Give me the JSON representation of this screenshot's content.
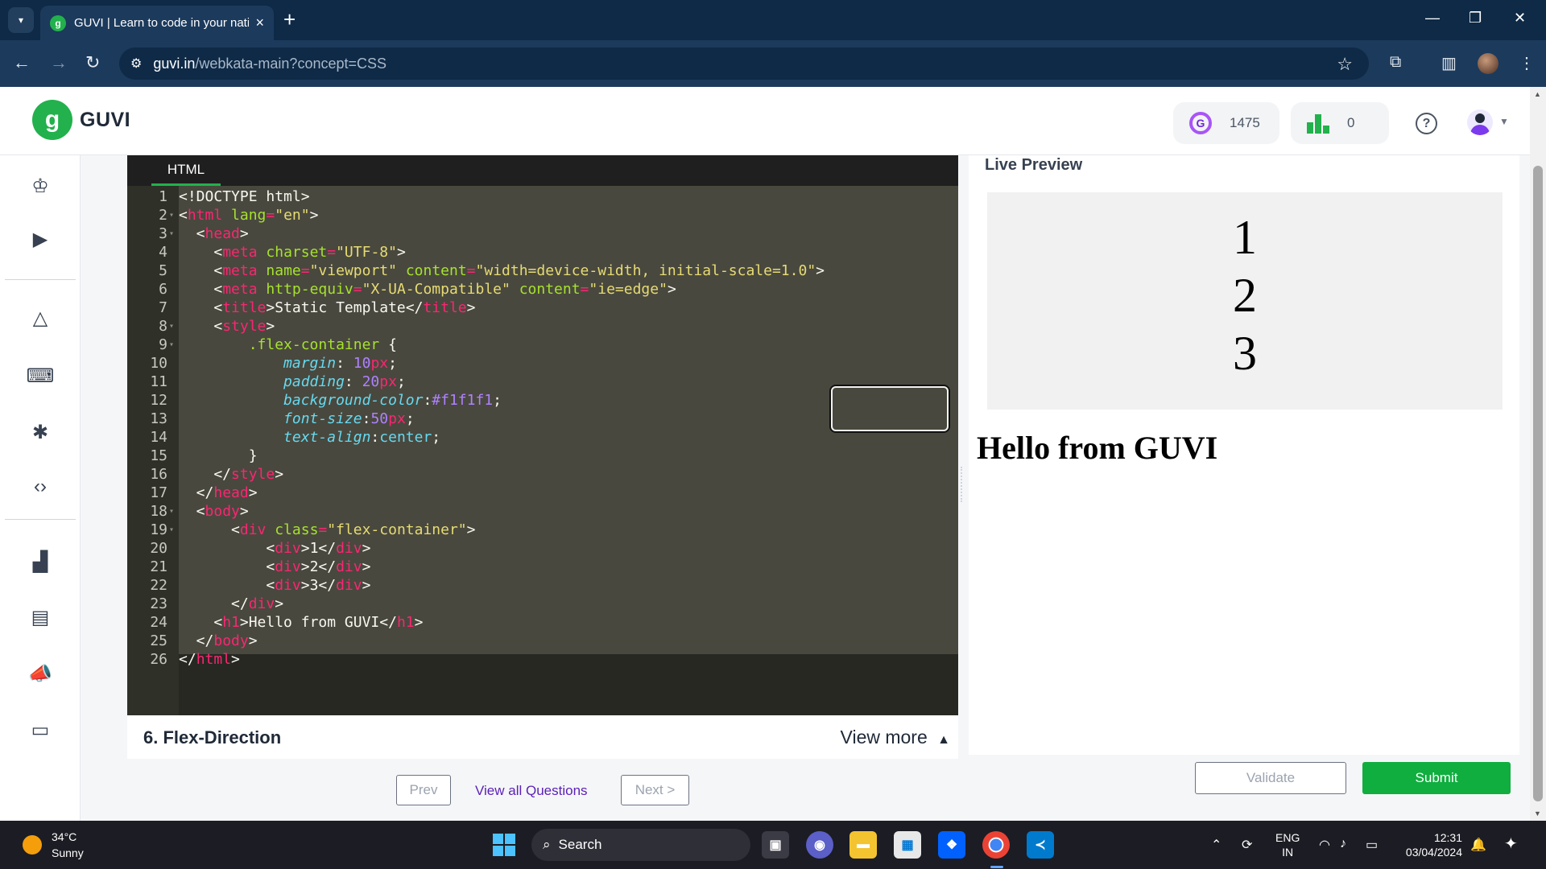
{
  "browser": {
    "tab_title": "GUVI | Learn to code in your native language",
    "tab_favicon": "g",
    "url_host": "guvi.in",
    "url_path": "/webkata-main?concept=CSS"
  },
  "header": {
    "logo_letter": "g",
    "logo_text": "GUVI",
    "gems_icon_letter": "G",
    "gems": "1475",
    "rank": "0",
    "help": "?"
  },
  "editor": {
    "tab_label": "HTML",
    "lines": [
      {
        "n": "1",
        "fold": "",
        "html": "<span>&lt;!DOCTYPE html&gt;</span>"
      },
      {
        "n": "2",
        "fold": "▾",
        "html": "&lt;<span class='ct'>html</span> <span class='ca'>lang</span><span class='ct'>=</span><span class='cs'>\"en\"</span>&gt;"
      },
      {
        "n": "3",
        "fold": "▾",
        "html": "  &lt;<span class='ct'>head</span>&gt;"
      },
      {
        "n": "4",
        "fold": "",
        "html": "    &lt;<span class='ct'>meta</span> <span class='ca'>charset</span><span class='ct'>=</span><span class='cs'>\"UTF-8\"</span>&gt;"
      },
      {
        "n": "5",
        "fold": "",
        "html": "    &lt;<span class='ct'>meta</span> <span class='ca'>name</span><span class='ct'>=</span><span class='cs'>\"viewport\"</span> <span class='ca'>content</span><span class='ct'>=</span><span class='cs'>\"width=device-width, initial-scale=1.0\"</span>&gt;"
      },
      {
        "n": "6",
        "fold": "",
        "html": "    &lt;<span class='ct'>meta</span> <span class='ca'>http-equiv</span><span class='ct'>=</span><span class='cs'>\"X-UA-Compatible\"</span> <span class='ca'>content</span><span class='ct'>=</span><span class='cs'>\"ie=edge\"</span>&gt;"
      },
      {
        "n": "7",
        "fold": "",
        "html": "    &lt;<span class='ct'>title</span>&gt;Static Template&lt;/<span class='ct'>title</span>&gt;"
      },
      {
        "n": "8",
        "fold": "▾",
        "html": "    &lt;<span class='ct'>style</span>&gt;"
      },
      {
        "n": "9",
        "fold": "▾",
        "html": "        <span class='ca'>.flex-container</span> {"
      },
      {
        "n": "10",
        "fold": "",
        "html": "            <span class='cp'>margin</span>: <span class='cn'>10</span><span class='ct'>px</span>;"
      },
      {
        "n": "11",
        "fold": "",
        "html": "            <span class='cp'>padding</span>: <span class='cn'>20</span><span class='ct'>px</span>;"
      },
      {
        "n": "12",
        "fold": "",
        "html": "            <span class='cp'>background-color</span>:<span class='cn'>#f1f1f1</span>;"
      },
      {
        "n": "13",
        "fold": "",
        "html": "            <span class='cp'>font-size</span>:<span class='cn'>50</span><span class='ct'>px</span>;"
      },
      {
        "n": "14",
        "fold": "",
        "html": "            <span class='cp'>text-align</span>:<span class='cv'>center</span>;"
      },
      {
        "n": "15",
        "fold": "",
        "html": "        }"
      },
      {
        "n": "16",
        "fold": "",
        "html": "    &lt;/<span class='ct'>style</span>&gt;"
      },
      {
        "n": "17",
        "fold": "",
        "html": "  &lt;/<span class='ct'>head</span>&gt;"
      },
      {
        "n": "18",
        "fold": "▾",
        "html": "  &lt;<span class='ct'>body</span>&gt;"
      },
      {
        "n": "19",
        "fold": "▾",
        "html": "      &lt;<span class='ct'>div</span> <span class='ca'>class</span><span class='ct'>=</span><span class='cs'>\"flex-container\"</span>&gt;"
      },
      {
        "n": "20",
        "fold": "",
        "html": "          &lt;<span class='ct'>div</span>&gt;1&lt;/<span class='ct'>div</span>&gt;"
      },
      {
        "n": "21",
        "fold": "",
        "html": "          &lt;<span class='ct'>div</span>&gt;2&lt;/<span class='ct'>div</span>&gt;"
      },
      {
        "n": "22",
        "fold": "",
        "html": "          &lt;<span class='ct'>div</span>&gt;3&lt;/<span class='ct'>div</span>&gt;"
      },
      {
        "n": "23",
        "fold": "",
        "html": "      &lt;/<span class='ct'>div</span>&gt;"
      },
      {
        "n": "24",
        "fold": "",
        "html": "    &lt;<span class='ct'>h1</span>&gt;Hello from GUVI&lt;/<span class='ct'>h1</span>&gt;"
      },
      {
        "n": "25",
        "fold": "",
        "html": "  &lt;/<span class='ct'>body</span>&gt;"
      },
      {
        "n": "26",
        "fold": "",
        "html": "&lt;/<span class='ct'>html</span>&gt;"
      }
    ]
  },
  "question": {
    "title": "6. Flex-Direction",
    "view_more": "View more"
  },
  "pager": {
    "prev": "Prev",
    "view_all": "View all Questions",
    "next": "Next >"
  },
  "preview": {
    "title": "Live Preview",
    "items": [
      "1",
      "2",
      "3"
    ],
    "heading": "Hello from GUVI"
  },
  "actions": {
    "validate": "Validate",
    "submit": "Submit"
  },
  "taskbar": {
    "temp": "34°C",
    "condition": "Sunny",
    "search": "Search",
    "lang1": "ENG",
    "lang2": "IN",
    "time": "12:31",
    "date": "03/04/2024"
  },
  "colors": {
    "brand_green": "#22b14c",
    "submit_green": "#0fae3f",
    "editor_bg": "#272822",
    "chrome_dark": "#0e2a47"
  }
}
